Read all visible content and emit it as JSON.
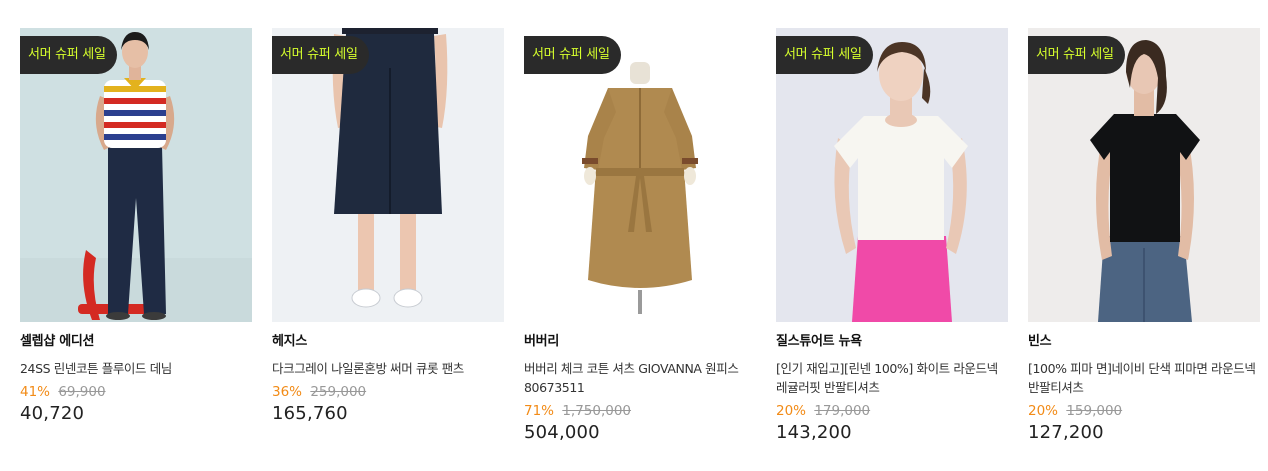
{
  "products": [
    {
      "badge": "서머 슈퍼 세일",
      "brand": "셀렙샵 에디션",
      "title": "24SS 린넨코튼 플루이드 데님",
      "discount": "41%",
      "original_price": "69,900",
      "sale_price": "40,720",
      "image_icon": "woman-striped-polo-jeans"
    },
    {
      "badge": "서머 슈퍼 세일",
      "brand": "헤지스",
      "title": "다크그레이 나일론혼방 써머 큐롯 팬츠",
      "discount": "36%",
      "original_price": "259,000",
      "sale_price": "165,760",
      "image_icon": "navy-culotte-pants"
    },
    {
      "badge": "서머 슈퍼 세일",
      "brand": "버버리",
      "title": "버버리 체크 코튼 셔츠 GIOVANNA 원피스 80673511",
      "discount": "71%",
      "original_price": "1,750,000",
      "sale_price": "504,000",
      "image_icon": "camel-shirt-dress-mannequin"
    },
    {
      "badge": "서머 슈퍼 세일",
      "brand": "질스튜어트 뉴욕",
      "title": "[인기 재입고][린넨 100%] 화이트 라운드넥 레귤러핏 반팔티셔츠",
      "discount": "20%",
      "original_price": "179,000",
      "sale_price": "143,200",
      "image_icon": "white-linen-tshirt-pink-pants"
    },
    {
      "badge": "서머 슈퍼 세일",
      "brand": "빈스",
      "title": "[100% 피마 면]네이비 단색 피마면 라운드넥 반팔티셔츠",
      "discount": "20%",
      "original_price": "159,000",
      "sale_price": "127,200",
      "image_icon": "black-tshirt-jeans"
    }
  ],
  "colors": {
    "badge_background": "#2a2a2a",
    "badge_text": "#d6ff2c",
    "discount": "#f28b17",
    "original_price": "#999999"
  }
}
